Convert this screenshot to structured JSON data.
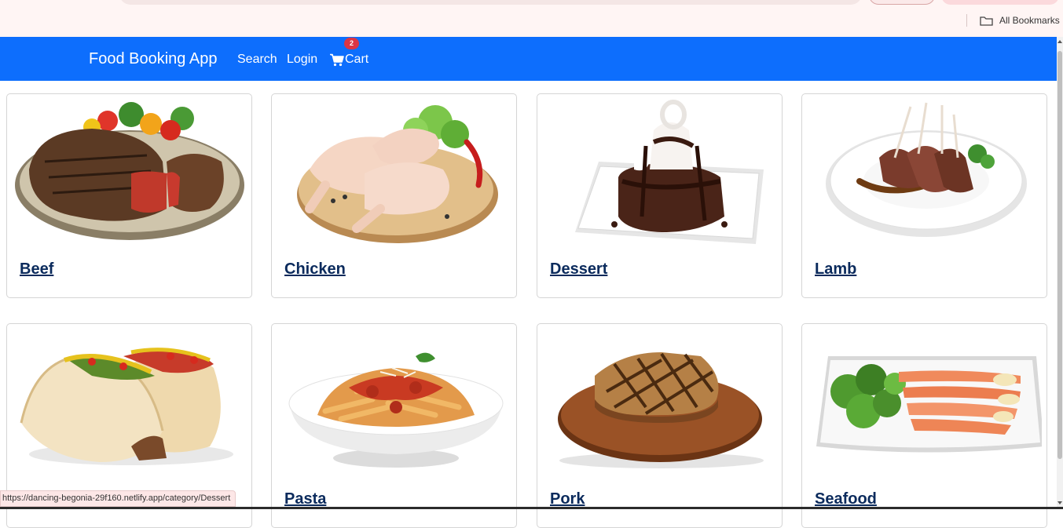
{
  "browser": {
    "bookmarks_label": "All Bookmarks",
    "status_url": "https://dancing-begonia-29f160.netlify.app/category/Dessert"
  },
  "navbar": {
    "brand": "Food Booking App",
    "links": {
      "search": "Search",
      "login": "Login",
      "cart": "Cart"
    },
    "cart_count": "2",
    "color": "#0d6efd"
  },
  "categories": [
    {
      "name": "Beef",
      "icon": "beef-steak-image"
    },
    {
      "name": "Chicken",
      "icon": "chicken-legs-image"
    },
    {
      "name": "Dessert",
      "icon": "chocolate-cake-image"
    },
    {
      "name": "Lamb",
      "icon": "lamb-chops-image"
    },
    {
      "name": "",
      "icon": "tacos-image"
    },
    {
      "name": "Pasta",
      "icon": "pasta-image"
    },
    {
      "name": "Pork",
      "icon": "pork-chop-image"
    },
    {
      "name": "Seafood",
      "icon": "salmon-platter-image"
    }
  ]
}
